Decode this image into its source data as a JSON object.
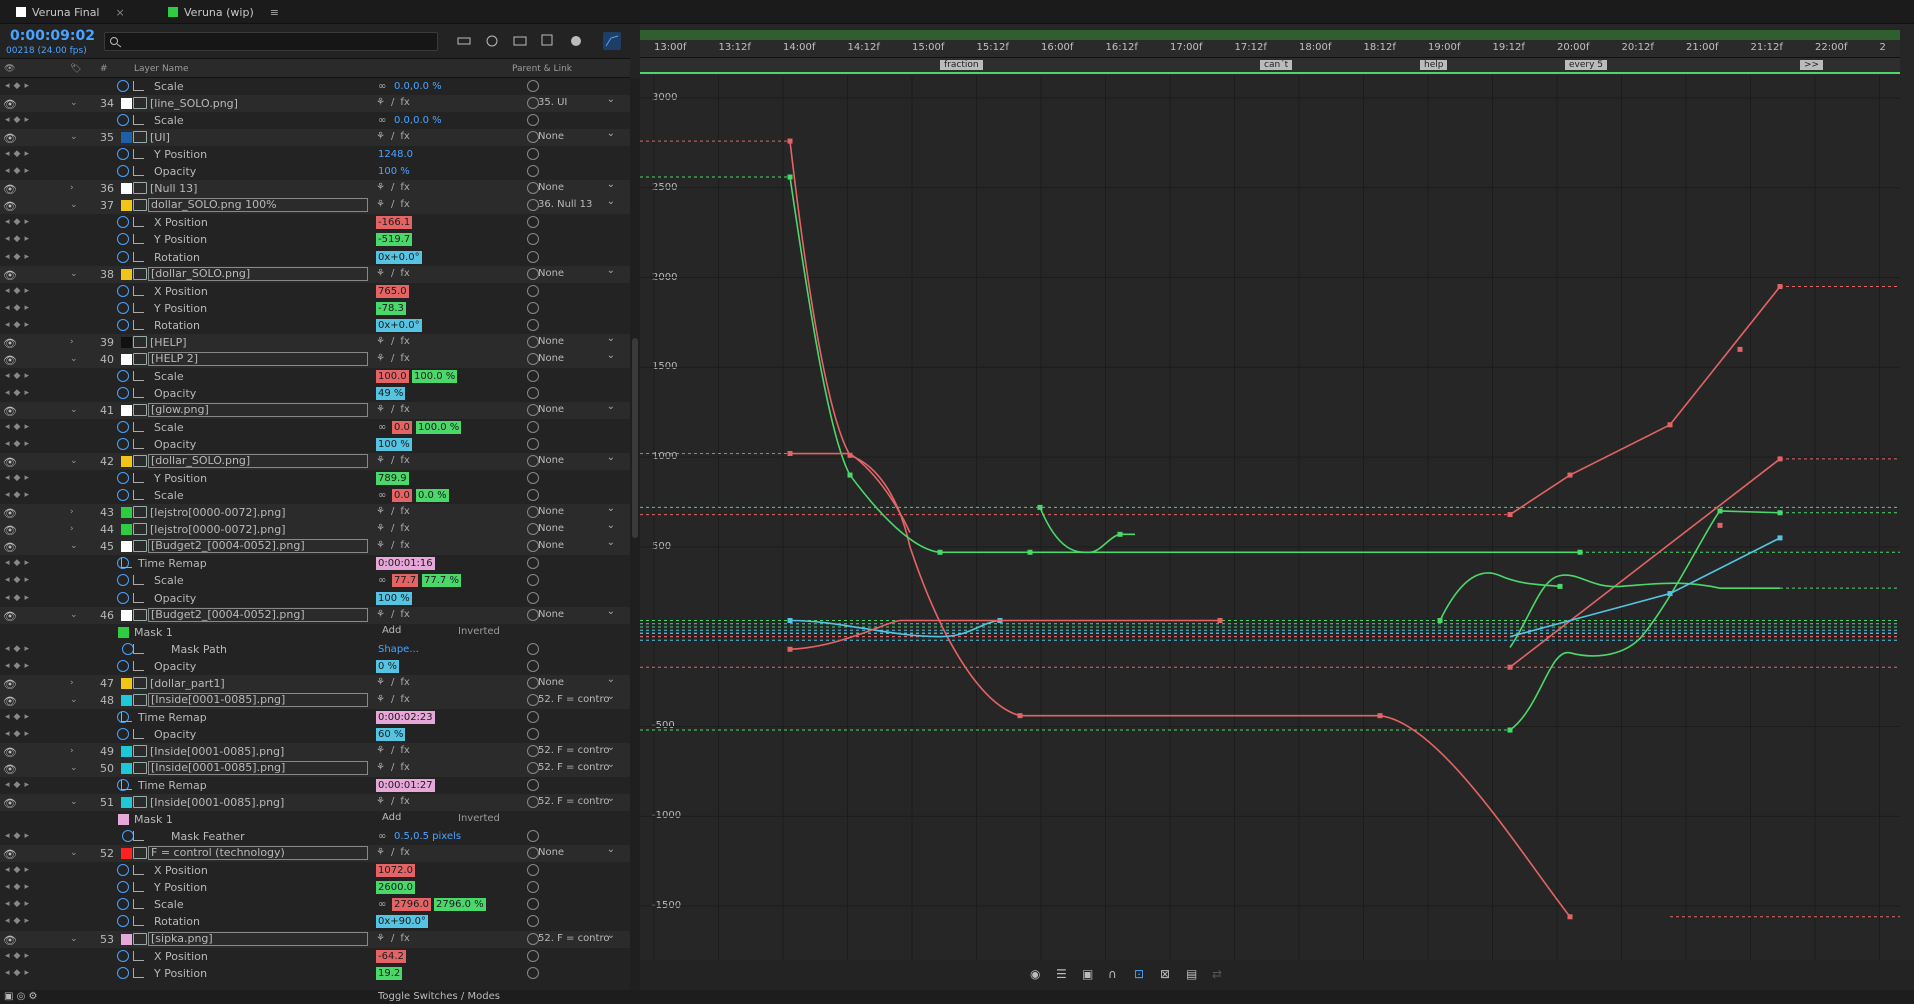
{
  "tabs": [
    {
      "label": "Veruna Final",
      "color": "#ffffff"
    },
    {
      "label": "Veruna (wip)",
      "color": "#2ecc40"
    }
  ],
  "header": {
    "timecode": "0:00:09:02",
    "frames": "00218 (24.00 fps)",
    "search_placeholder": ""
  },
  "columns": {
    "hash": "#",
    "layer_name": "Layer Name",
    "parent_link": "Parent & Link"
  },
  "rows": [
    {
      "type": "prop",
      "name": "Scale",
      "value": "0.0,0.0 %",
      "vc": "blu",
      "link": true
    },
    {
      "type": "layer",
      "num": "34",
      "label": "#ffffff",
      "name": "[line_SOLO.png]",
      "twirl": "⌄",
      "parent": "35. UI"
    },
    {
      "type": "prop",
      "name": "Scale",
      "value": "0.0,0.0 %",
      "vc": "blu",
      "link": true
    },
    {
      "type": "layer",
      "num": "35",
      "label": "#1f5fa8",
      "name": "[UI]",
      "twirl": "⌄",
      "parent": "None"
    },
    {
      "type": "prop",
      "name": "Y Position",
      "value": "1248.0",
      "vc": "blu"
    },
    {
      "type": "prop",
      "name": "Opacity",
      "value": "100 %",
      "vc": "blu"
    },
    {
      "type": "layer",
      "num": "36",
      "label": "#ffffff",
      "name": "[Null 13]",
      "twirl": "›",
      "parent": "None"
    },
    {
      "type": "layer",
      "num": "37",
      "label": "#f0c419",
      "name": "dollar_SOLO.png 100%",
      "twirl": "⌄",
      "parent": "36. Null 13",
      "boxed": true
    },
    {
      "type": "prop",
      "name": "X Position",
      "value": "-166.1",
      "vc": "red"
    },
    {
      "type": "prop",
      "name": "Y Position",
      "value": "-519.7",
      "vc": "grn"
    },
    {
      "type": "prop",
      "name": "Rotation",
      "value": "0x+0.0°",
      "vc": "cyn"
    },
    {
      "type": "layer",
      "num": "38",
      "label": "#f0c419",
      "name": "[dollar_SOLO.png]",
      "twirl": "⌄",
      "parent": "None",
      "boxed": true
    },
    {
      "type": "prop",
      "name": "X Position",
      "value": "765.0",
      "vc": "red"
    },
    {
      "type": "prop",
      "name": "Y Position",
      "value": "-78.3",
      "vc": "grn"
    },
    {
      "type": "prop",
      "name": "Rotation",
      "value": "0x+0.0°",
      "vc": "cyn"
    },
    {
      "type": "layer",
      "num": "39",
      "label": "#111111",
      "name": "[HELP]",
      "twirl": "›",
      "parent": "None"
    },
    {
      "type": "layer",
      "num": "40",
      "label": "#ffffff",
      "name": "[HELP 2]",
      "twirl": "⌄",
      "parent": "None",
      "boxed": true
    },
    {
      "type": "prop",
      "name": "Scale",
      "value": "100.0",
      "vc": "red",
      "value2": "100.0 %",
      "vc2": "grn"
    },
    {
      "type": "prop",
      "name": "Opacity",
      "value": "49 %",
      "vc": "cyn"
    },
    {
      "type": "layer",
      "num": "41",
      "label": "#ffffff",
      "name": "[glow.png]",
      "twirl": "⌄",
      "parent": "None",
      "boxed": true
    },
    {
      "type": "prop",
      "name": "Scale",
      "value": "0.0",
      "vc": "red",
      "value2": "100.0 %",
      "vc2": "grn",
      "link": true
    },
    {
      "type": "prop",
      "name": "Opacity",
      "value": "100 %",
      "vc": "cyn"
    },
    {
      "type": "layer",
      "num": "42",
      "label": "#f0c419",
      "name": "[dollar_SOLO.png]",
      "twirl": "⌄",
      "parent": "None",
      "boxed": true
    },
    {
      "type": "prop",
      "name": "Y Position",
      "value": "789.9",
      "vc": "grn"
    },
    {
      "type": "prop",
      "name": "Scale",
      "value": "0.0",
      "vc": "red",
      "value2": "0.0 %",
      "vc2": "grn",
      "link": true
    },
    {
      "type": "layer",
      "num": "43",
      "label": "#2ecc40",
      "name": "[lejstro[0000-0072].png]",
      "twirl": "›",
      "parent": "None"
    },
    {
      "type": "layer",
      "num": "44",
      "label": "#2ecc40",
      "name": "[lejstro[0000-0072].png]",
      "twirl": "›",
      "parent": "None"
    },
    {
      "type": "layer",
      "num": "45",
      "label": "#ffffff",
      "name": "[Budget2_[0004-0052].png]",
      "twirl": "⌄",
      "parent": "None",
      "boxed": true
    },
    {
      "type": "prop",
      "name": "Time Remap",
      "value": "0:00:01:16",
      "vc": "pnk",
      "indent": true
    },
    {
      "type": "prop",
      "name": "Scale",
      "value": "77.7",
      "vc": "red",
      "value2": "77.7 %",
      "vc2": "grn",
      "link": true
    },
    {
      "type": "prop",
      "name": "Opacity",
      "value": "100 %",
      "vc": "cyn"
    },
    {
      "type": "layer",
      "num": "46",
      "label": "#ffffff",
      "name": "[Budget2_[0004-0052].png]",
      "twirl": "⌄",
      "parent": "None",
      "boxed": true
    },
    {
      "type": "mask",
      "name": "Mask 1",
      "mode": "Add",
      "inverted": "Inverted",
      "label": "#2ecc40"
    },
    {
      "type": "prop",
      "name": "Mask Path",
      "value": "Shape...",
      "vc": "blu",
      "deep": true
    },
    {
      "type": "prop",
      "name": "Opacity",
      "value": "0 %",
      "vc": "cyn"
    },
    {
      "type": "layer",
      "num": "47",
      "label": "#f0c419",
      "name": "[dollar_part1]",
      "twirl": "›",
      "parent": "None"
    },
    {
      "type": "layer",
      "num": "48",
      "label": "#1ec8d8",
      "name": "[Inside[0001-0085].png]",
      "twirl": "⌄",
      "parent": "52. F = contro",
      "boxed": true
    },
    {
      "type": "prop",
      "name": "Time Remap",
      "value": "0:00:02:23",
      "vc": "pnk",
      "indent": true
    },
    {
      "type": "prop",
      "name": "Opacity",
      "value": "60 %",
      "vc": "cyn"
    },
    {
      "type": "layer",
      "num": "49",
      "label": "#1ec8d8",
      "name": "[Inside[0001-0085].png]",
      "twirl": "›",
      "parent": "52. F = contro"
    },
    {
      "type": "layer",
      "num": "50",
      "label": "#1ec8d8",
      "name": "[Inside[0001-0085].png]",
      "twirl": "⌄",
      "parent": "52. F = contro",
      "boxed": true
    },
    {
      "type": "prop",
      "name": "Time Remap",
      "value": "0:00:01:27",
      "vc": "pnk",
      "indent": true
    },
    {
      "type": "layer",
      "num": "51",
      "label": "#1ec8d8",
      "name": "[Inside[0001-0085].png]",
      "twirl": "⌄",
      "parent": "52. F = contro"
    },
    {
      "type": "mask",
      "name": "Mask 1",
      "mode": "Add",
      "inverted": "Inverted",
      "label": "#e6a8d8"
    },
    {
      "type": "prop",
      "name": "Mask Feather",
      "value": "0.5,0.5 pixels",
      "vc": "blu",
      "link": true,
      "deep": true
    },
    {
      "type": "layer",
      "num": "52",
      "label": "#ff2222",
      "name": "F = control (technology)",
      "twirl": "⌄",
      "parent": "None",
      "boxed": true
    },
    {
      "type": "prop",
      "name": "X Position",
      "value": "1072.0",
      "vc": "red"
    },
    {
      "type": "prop",
      "name": "Y Position",
      "value": "2600.0",
      "vc": "grn"
    },
    {
      "type": "prop",
      "name": "Scale",
      "value": "2796.0",
      "vc": "red",
      "value2": "2796.0 %",
      "vc2": "grn",
      "link": true
    },
    {
      "type": "prop",
      "name": "Rotation",
      "value": "0x+90.0°",
      "vc": "cyn"
    },
    {
      "type": "layer",
      "num": "53",
      "label": "#e6a8d8",
      "name": "[sipka.png]",
      "twirl": "⌄",
      "parent": "52. F = contro",
      "boxed": true
    },
    {
      "type": "prop",
      "name": "X Position",
      "value": "-64.2",
      "vc": "red"
    },
    {
      "type": "prop",
      "name": "Y Position",
      "value": "19.2",
      "vc": "grn"
    }
  ],
  "ruler": [
    "13:00f",
    "13:12f",
    "14:00f",
    "14:12f",
    "15:00f",
    "15:12f",
    "16:00f",
    "16:12f",
    "17:00f",
    "17:12f",
    "18:00f",
    "18:12f",
    "19:00f",
    "19:12f",
    "20:00f",
    "20:12f",
    "21:00f",
    "21:12f",
    "22:00f",
    "2"
  ],
  "markers": [
    {
      "label": "fraction"
    },
    {
      "label": "can´t"
    },
    {
      "label": "help"
    },
    {
      "label": "every 5"
    },
    {
      "label": ">>"
    }
  ],
  "graph_axis": [
    "3000",
    "2500",
    "2000",
    "1500",
    "1000",
    "500",
    "",
    "-500",
    "-1000",
    "-1500"
  ],
  "colors": {
    "red": "#e46466",
    "green": "#4bd86b",
    "cyan": "#55c4e2",
    "accent": "#4aa3ff"
  },
  "footer": {
    "toggle": "Toggle Switches / Modes"
  }
}
